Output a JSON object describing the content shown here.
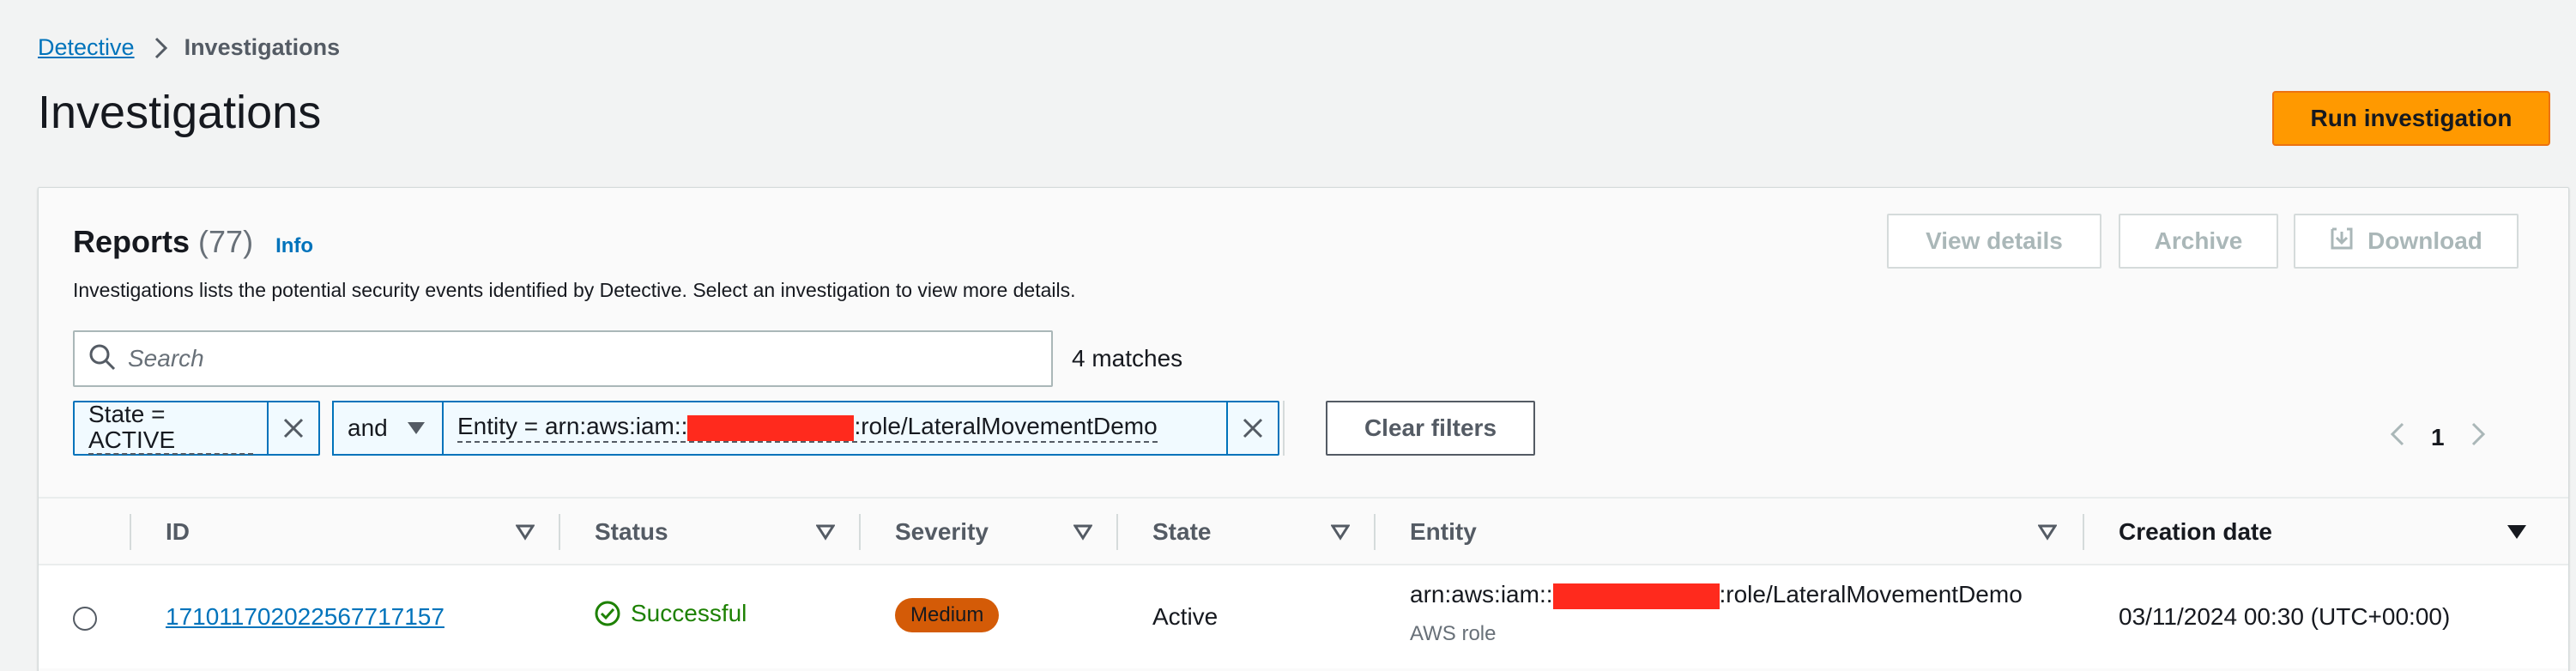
{
  "breadcrumb": {
    "root": "Detective",
    "current": "Investigations"
  },
  "page": {
    "title": "Investigations",
    "run_button": "Run investigation"
  },
  "reports": {
    "title": "Reports",
    "count": "(77)",
    "info_link": "Info",
    "description": "Investigations lists the potential security events identified by Detective. Select an investigation to view more details.",
    "buttons": {
      "view_details": "View details",
      "archive": "Archive",
      "download": "Download"
    }
  },
  "search": {
    "placeholder": "Search",
    "value": "",
    "matches": "4 matches"
  },
  "filters": {
    "token1": "State = ACTIVE",
    "operator": "and",
    "token2_prefix": "Entity = arn:aws:iam::",
    "token2_suffix": ":role/LateralMovementDemo",
    "clear": "Clear filters"
  },
  "pagination": {
    "current_page": "1"
  },
  "table": {
    "columns": {
      "id": "ID",
      "status": "Status",
      "severity": "Severity",
      "state": "State",
      "entity": "Entity",
      "creation_date": "Creation date"
    },
    "rows": [
      {
        "id": "171011702022567717157",
        "status": "Successful",
        "severity": "Medium",
        "state": "Active",
        "entity_prefix": "arn:aws:iam::",
        "entity_suffix": ":role/LateralMovementDemo",
        "entity_type": "AWS role",
        "creation_date": "03/11/2024 00:30 (UTC+00:00)"
      }
    ]
  },
  "colors": {
    "primary": "#ff9900",
    "link": "#0073bb",
    "success": "#1d8102",
    "severity_medium": "#d45b07",
    "redaction": "#ff2a1d"
  }
}
